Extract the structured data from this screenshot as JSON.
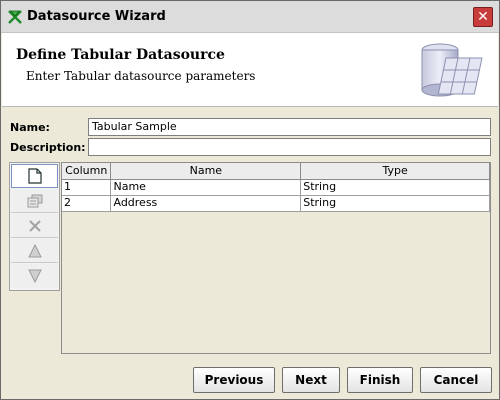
{
  "window": {
    "title": "Datasource Wizard",
    "close_label": "✕"
  },
  "header": {
    "title": "Define Tabular Datasource",
    "subtitle": "Enter Tabular datasource parameters"
  },
  "form": {
    "name_label": "Name:",
    "name_value": "Tabular Sample",
    "description_label": "Description:",
    "description_value": ""
  },
  "toolbar": {
    "buttons": [
      {
        "icon": "new-row-icon",
        "enabled": true
      },
      {
        "icon": "copy-row-icon",
        "enabled": false
      },
      {
        "icon": "delete-row-icon",
        "enabled": false
      },
      {
        "icon": "move-up-icon",
        "enabled": false
      },
      {
        "icon": "move-down-icon",
        "enabled": false
      }
    ]
  },
  "table": {
    "columns": [
      "Column",
      "Name",
      "Type"
    ],
    "rows": [
      [
        "1",
        "Name",
        "String"
      ],
      [
        "2",
        "Address",
        "String"
      ]
    ]
  },
  "buttons": {
    "previous": "Previous",
    "next": "Next",
    "finish": "Finish",
    "cancel": "Cancel"
  }
}
